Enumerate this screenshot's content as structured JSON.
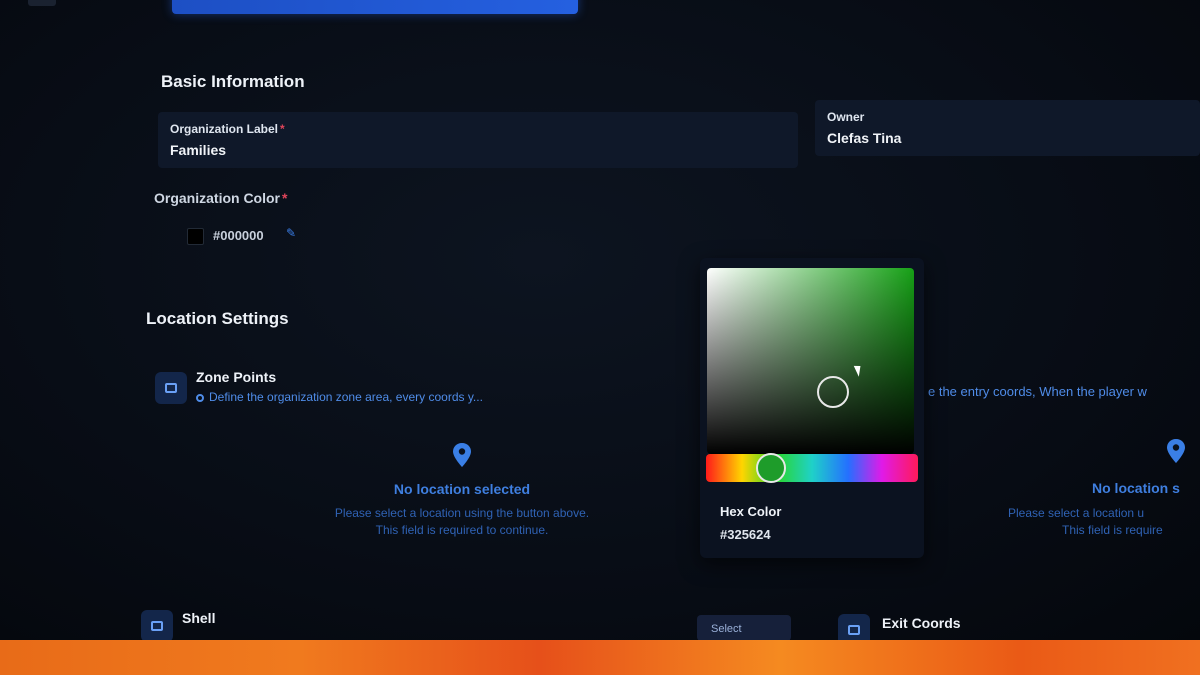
{
  "basic_info": {
    "title": "Basic Information",
    "org_label": {
      "label": "Organization Label",
      "required": "*",
      "value": "Families"
    },
    "owner": {
      "label": "Owner",
      "value": "Clefas Tina"
    },
    "org_color": {
      "label": "Organization Color",
      "required": "*",
      "value": "#000000",
      "swatch": "#000000"
    }
  },
  "location": {
    "title": "Location Settings",
    "zone_points": {
      "title": "Zone Points",
      "desc": "Define the organization zone area, every coords y...",
      "empty_title": "No location selected",
      "empty_line1": "Please select a location using the button above.",
      "empty_line2": "This field is required to continue."
    },
    "entry": {
      "desc": "e the entry coords, When the player w",
      "empty_title": "No location s",
      "empty_line1": "Please select a location u",
      "empty_line2": "This field is require"
    },
    "shell": {
      "title": "Shell"
    },
    "select_button": "Select",
    "exit_coords": {
      "title": "Exit Coords"
    }
  },
  "color_picker": {
    "hex_label": "Hex Color",
    "hex_value": "#325624",
    "hue_color": "#16a016"
  }
}
